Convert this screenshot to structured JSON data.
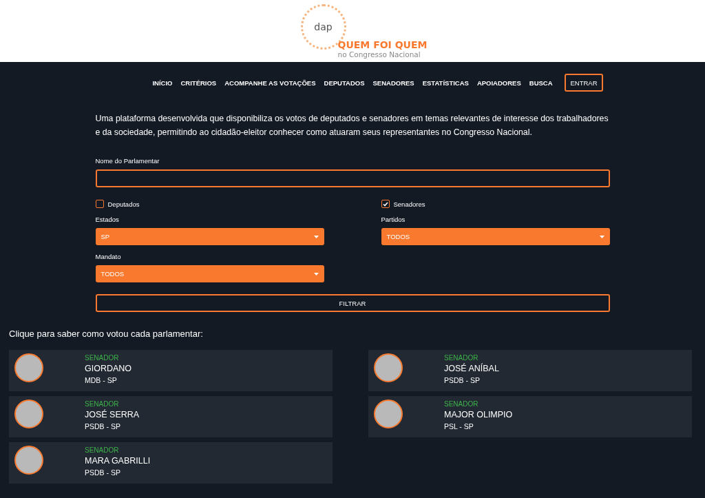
{
  "logo": {
    "mark": "dap",
    "title": "QUEM FOI QUEM",
    "subtitle": "no Congresso Nacional"
  },
  "nav": {
    "items": [
      "INÍCIO",
      "CRITÉRIOS",
      "ACOMPANHE AS VOTAÇÕES",
      "DEPUTADOS",
      "SENADORES",
      "ESTATÍSTICAS",
      "APOIADORES",
      "BUSCA"
    ],
    "login": "ENTRAR"
  },
  "intro": "Uma plataforma desenvolvida que disponibiliza os votos de deputados e senadores em temas relevantes de interesse dos trabalhadores e da sociedade, permitindo ao cidadão-eleitor conhecer como atuaram seus representantes no Congresso Nacional.",
  "form": {
    "name_label": "Nome do Parlamentar",
    "checkboxes": [
      {
        "label": "Deputados",
        "checked": false
      },
      {
        "label": "Senadores",
        "checked": true
      }
    ],
    "selects": [
      {
        "label": "Estados",
        "value": "SP"
      },
      {
        "label": "Partidos",
        "value": "TODOS"
      },
      {
        "label": "Mandato",
        "value": "TODOS"
      }
    ],
    "submit": "FILTRAR"
  },
  "results_title": "Clique para saber como votou cada parlamentar:",
  "parliamentarians": [
    {
      "role": "SENADOR",
      "name": "GIORDANO",
      "party": "MDB - SP"
    },
    {
      "role": "SENADOR",
      "name": "JOSÉ ANÍBAL",
      "party": "PSDB - SP"
    },
    {
      "role": "SENADOR",
      "name": "JOSÉ SERRA",
      "party": "PSDB - SP"
    },
    {
      "role": "SENADOR",
      "name": "MAJOR OLIMPIO",
      "party": "PSL - SP"
    },
    {
      "role": "SENADOR",
      "name": "MARA GABRILLI",
      "party": "PSDB - SP"
    }
  ]
}
